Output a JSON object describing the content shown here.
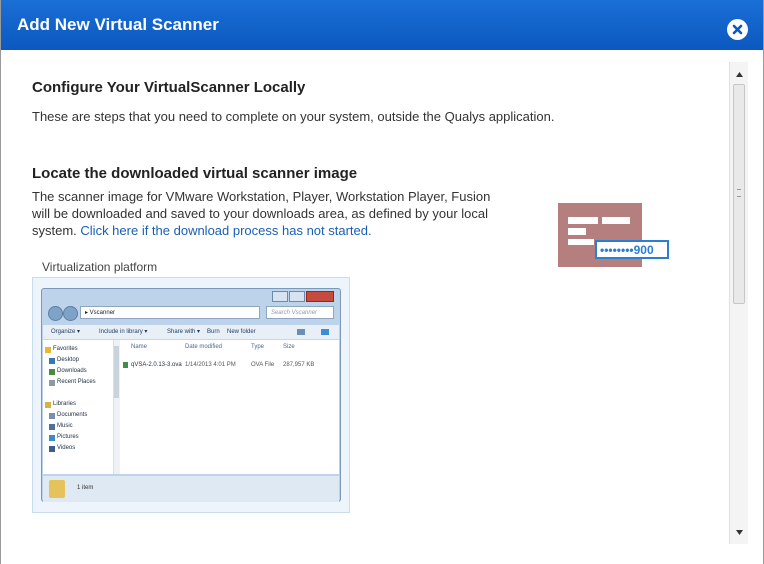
{
  "dialog": {
    "title": "Add New Virtual Scanner",
    "close_icon": "close-icon"
  },
  "section1": {
    "heading": "Configure Your VirtualScanner Locally",
    "text": "These are steps that you need to complete on your system, outside the Qualys application."
  },
  "section2": {
    "heading": "Locate the downloaded virtual scanner image",
    "text_line1": "The scanner image for VMware Workstation, Player, Workstation Player, Fusion",
    "text_line2": "will be downloaded and saved to your downloads area, as defined by your local",
    "text_line3_prefix": "system. ",
    "link": "Click here if the download process has not started."
  },
  "scanner_icon": {
    "badge_text": "••••••••900"
  },
  "platform": {
    "label": "Virtualization platform"
  },
  "explorer": {
    "path": "▸ Vscanner",
    "search_placeholder": "Search Vscanner",
    "toolbar": [
      "Organize ▾",
      "Include in library ▾",
      "Share with ▾",
      "Burn",
      "New folder"
    ],
    "nav": {
      "favorites": "Favorites",
      "desktop": "Desktop",
      "downloads": "Downloads",
      "recent": "Recent Places",
      "libraries": "Libraries",
      "documents": "Documents",
      "music": "Music",
      "pictures": "Pictures",
      "videos": "Videos"
    },
    "columns": [
      "Name",
      "Date modified",
      "Type",
      "Size"
    ],
    "file": {
      "name": "qVSA-2.0.13-3.ova",
      "date": "1/14/2013 4:01 PM",
      "type": "OVA File",
      "size": "287,957 KB"
    },
    "status": "1 item"
  },
  "colors": {
    "titlebar": "#0e61c8",
    "link": "#1a5fb4",
    "scanner_icon": "#b67f7f",
    "badge": "#2b7fd1"
  }
}
